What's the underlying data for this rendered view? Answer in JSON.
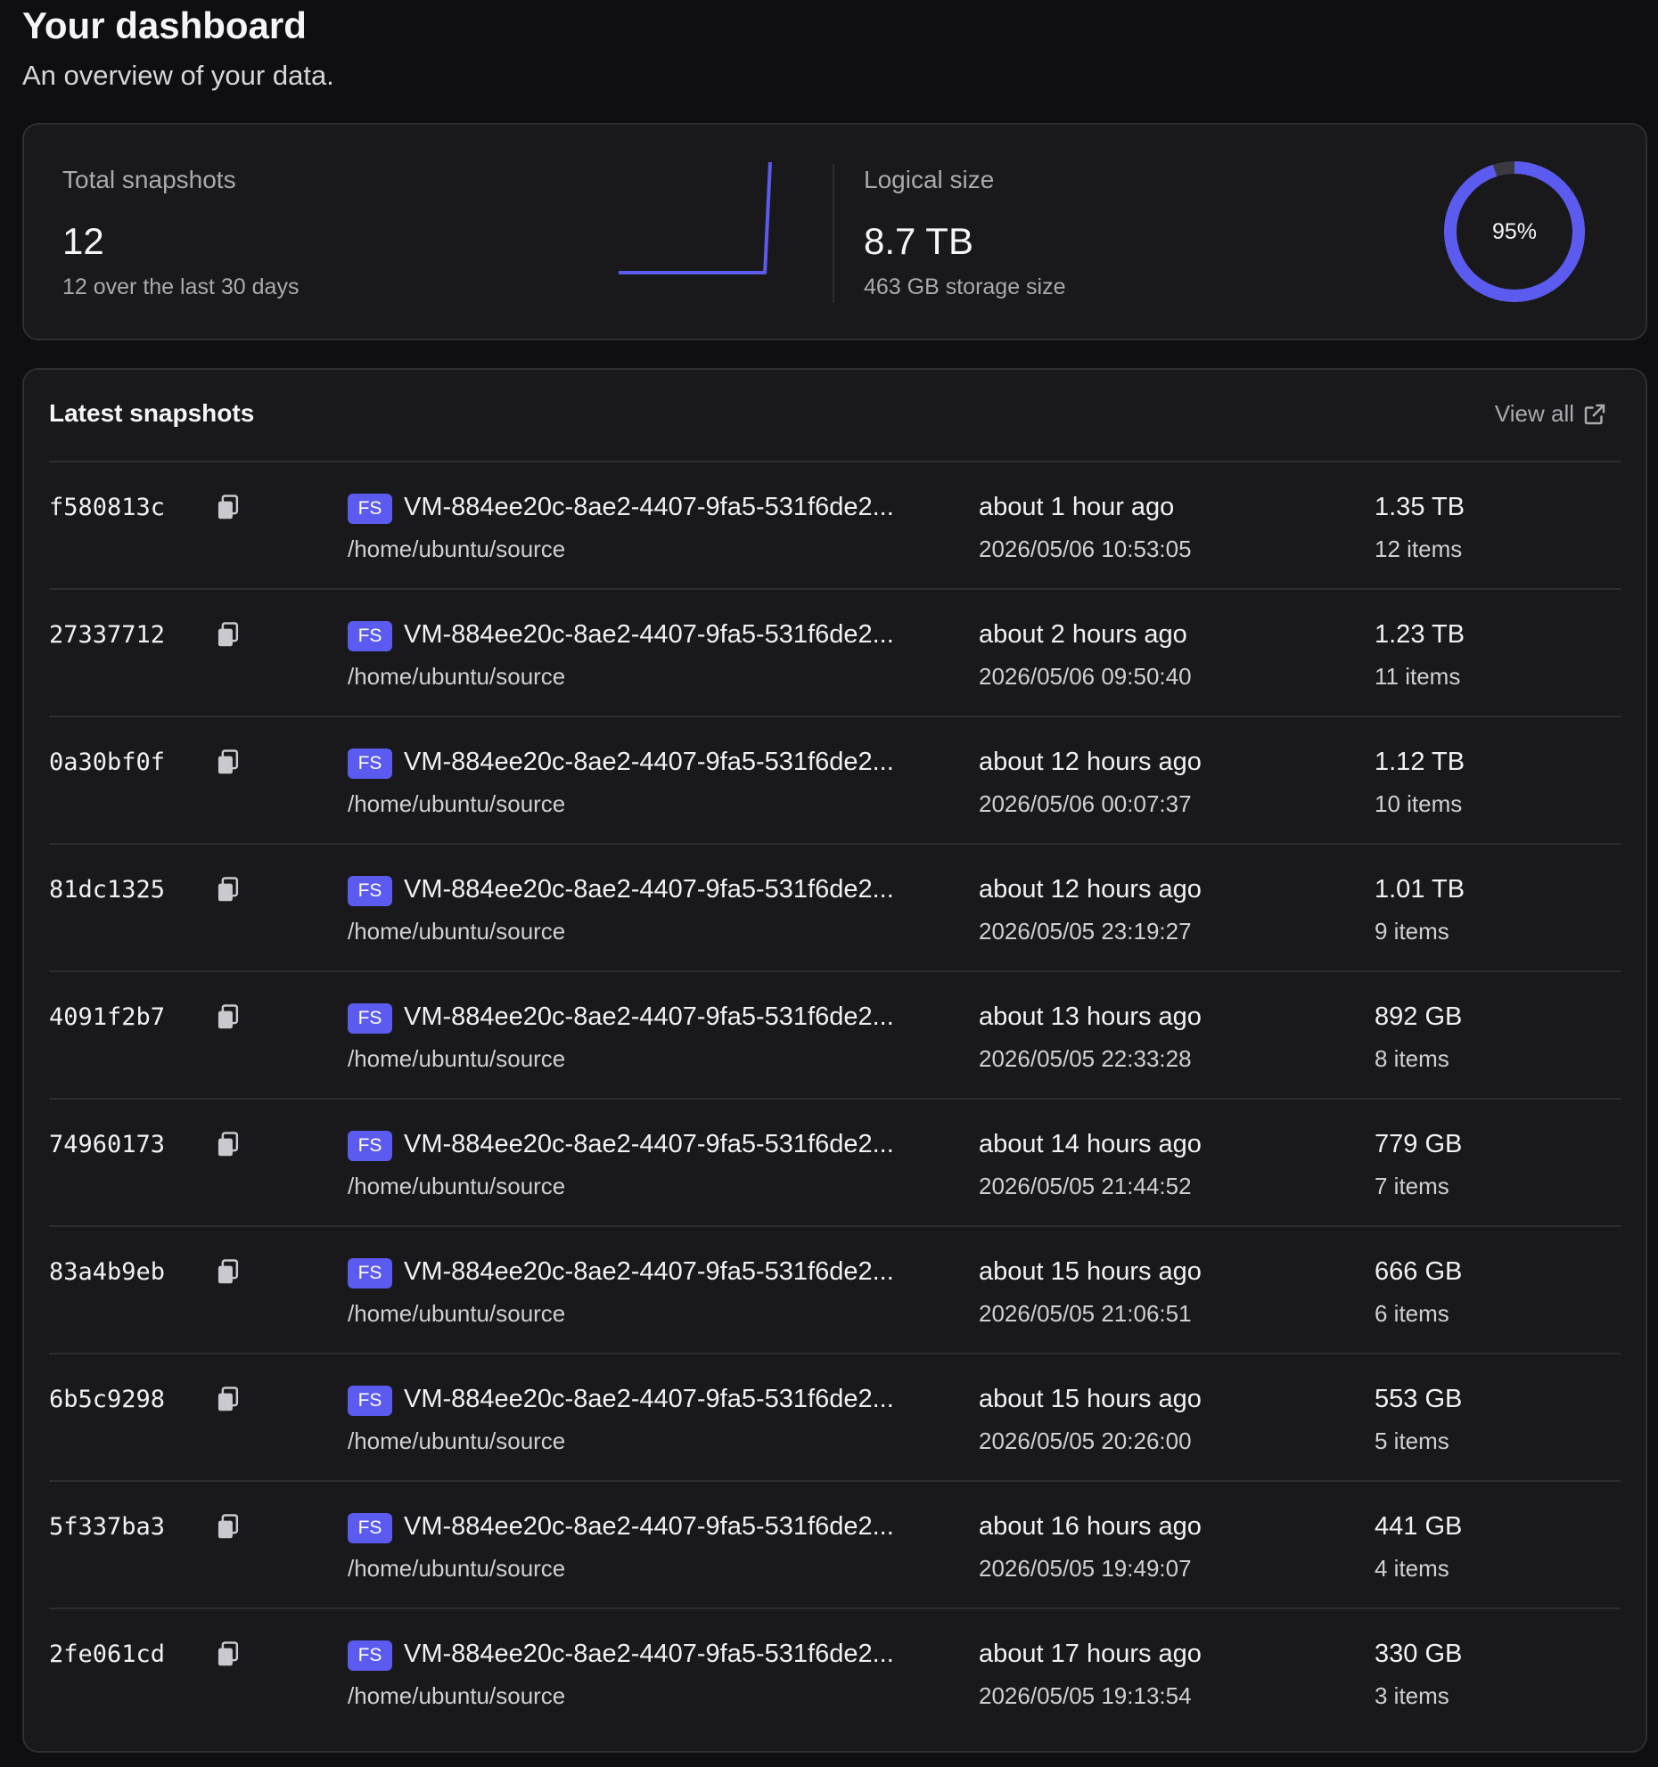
{
  "header": {
    "title": "Your dashboard",
    "subtitle": "An overview of your data."
  },
  "stats": {
    "snapshots": {
      "label": "Total snapshots",
      "value": "12",
      "sub": "12 over the last 30 days",
      "trend": [
        0,
        0,
        0,
        0,
        0,
        0,
        0,
        0,
        0,
        0,
        0,
        0,
        0,
        0,
        0,
        0,
        0,
        0,
        0,
        0,
        0,
        0,
        0,
        0,
        0,
        0,
        0,
        0,
        0,
        12
      ]
    },
    "logical": {
      "label": "Logical size",
      "value": "8.7 TB",
      "sub": "463 GB storage size",
      "percent_label": "95%",
      "percent": 95
    }
  },
  "colors": {
    "accent": "#5b5bf0",
    "track": "#3a3a40"
  },
  "latest": {
    "title": "Latest snapshots",
    "view_all": "View all",
    "rows": [
      {
        "id": "f580813c",
        "badge": "FS",
        "vm": "VM-884ee20c-8ae2-4407-9fa5-531f6de2...",
        "path": "/home/ubuntu/source",
        "relative": "about 1 hour ago",
        "absolute": "2026/05/06 10:53:05",
        "size": "1.35 TB",
        "items": "12 items"
      },
      {
        "id": "27337712",
        "badge": "FS",
        "vm": "VM-884ee20c-8ae2-4407-9fa5-531f6de2...",
        "path": "/home/ubuntu/source",
        "relative": "about 2 hours ago",
        "absolute": "2026/05/06 09:50:40",
        "size": "1.23 TB",
        "items": "11 items"
      },
      {
        "id": "0a30bf0f",
        "badge": "FS",
        "vm": "VM-884ee20c-8ae2-4407-9fa5-531f6de2...",
        "path": "/home/ubuntu/source",
        "relative": "about 12 hours ago",
        "absolute": "2026/05/06 00:07:37",
        "size": "1.12 TB",
        "items": "10 items"
      },
      {
        "id": "81dc1325",
        "badge": "FS",
        "vm": "VM-884ee20c-8ae2-4407-9fa5-531f6de2...",
        "path": "/home/ubuntu/source",
        "relative": "about 12 hours ago",
        "absolute": "2026/05/05 23:19:27",
        "size": "1.01 TB",
        "items": "9 items"
      },
      {
        "id": "4091f2b7",
        "badge": "FS",
        "vm": "VM-884ee20c-8ae2-4407-9fa5-531f6de2...",
        "path": "/home/ubuntu/source",
        "relative": "about 13 hours ago",
        "absolute": "2026/05/05 22:33:28",
        "size": "892 GB",
        "items": "8 items"
      },
      {
        "id": "74960173",
        "badge": "FS",
        "vm": "VM-884ee20c-8ae2-4407-9fa5-531f6de2...",
        "path": "/home/ubuntu/source",
        "relative": "about 14 hours ago",
        "absolute": "2026/05/05 21:44:52",
        "size": "779 GB",
        "items": "7 items"
      },
      {
        "id": "83a4b9eb",
        "badge": "FS",
        "vm": "VM-884ee20c-8ae2-4407-9fa5-531f6de2...",
        "path": "/home/ubuntu/source",
        "relative": "about 15 hours ago",
        "absolute": "2026/05/05 21:06:51",
        "size": "666 GB",
        "items": "6 items"
      },
      {
        "id": "6b5c9298",
        "badge": "FS",
        "vm": "VM-884ee20c-8ae2-4407-9fa5-531f6de2...",
        "path": "/home/ubuntu/source",
        "relative": "about 15 hours ago",
        "absolute": "2026/05/05 20:26:00",
        "size": "553 GB",
        "items": "5 items"
      },
      {
        "id": "5f337ba3",
        "badge": "FS",
        "vm": "VM-884ee20c-8ae2-4407-9fa5-531f6de2...",
        "path": "/home/ubuntu/source",
        "relative": "about 16 hours ago",
        "absolute": "2026/05/05 19:49:07",
        "size": "441 GB",
        "items": "4 items"
      },
      {
        "id": "2fe061cd",
        "badge": "FS",
        "vm": "VM-884ee20c-8ae2-4407-9fa5-531f6de2...",
        "path": "/home/ubuntu/source",
        "relative": "about 17 hours ago",
        "absolute": "2026/05/05 19:13:54",
        "size": "330 GB",
        "items": "3 items"
      }
    ]
  }
}
